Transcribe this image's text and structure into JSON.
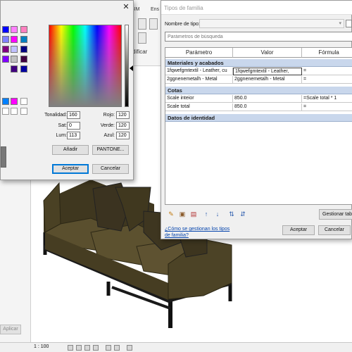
{
  "background": {
    "ribbon_tabs": [
      "BIM",
      "Ens"
    ],
    "ribbon_modify": "dificar",
    "apply_button": "Aplicar",
    "status_scale": "1 : 100"
  },
  "color_dialog": {
    "close_symbol": "✕",
    "fields": {
      "tonalidad": {
        "label": "Tonalidad:",
        "value": "160"
      },
      "sat": {
        "label": "Sat:",
        "value": "0"
      },
      "lum": {
        "label": "Lum:",
        "value": "113"
      },
      "rojo": {
        "label": "Rojo:",
        "value": "120"
      },
      "verde": {
        "label": "Verde:",
        "value": "120"
      },
      "azul": {
        "label": "Azul:",
        "value": "120"
      }
    },
    "add_button": "Añadir",
    "pantone_button": "PANTONE...",
    "accept_button": "Aceptar",
    "cancel_button": "Cancelar",
    "current_color": "#787878",
    "basic_colors": [
      "#0000ff",
      "#ff80ff",
      "#ff80c0",
      "#8080ff",
      "#ff00ff",
      "#0080c0",
      "#800080",
      "#c0c0ff",
      "#000080",
      "#8000ff",
      "#c0c0c0",
      "#400040",
      "#400080",
      "#0000a0"
    ],
    "custom_colors": [
      "#0080ff",
      "#ff00ff"
    ]
  },
  "type_dialog": {
    "title": "Tipos de familia",
    "type_name_label": "Nombre de tipo:",
    "search_placeholder": "Parámetros de búsqueda",
    "columns": [
      "Parámetro",
      "Valor",
      "Fórmula"
    ],
    "groups": [
      {
        "name": "Materiales y acabados",
        "rows": [
          {
            "param": "1fqwefgmtextil - Leather, cu",
            "value": "1fqwefgmtextil - Leather,",
            "formula": "="
          },
          {
            "param": "2ggnenemetalh - Metal",
            "value": "2ggnenemetalh - Metal",
            "formula": "="
          }
        ]
      },
      {
        "name": "Cotas",
        "rows": [
          {
            "param": "Scale inteior",
            "value": "850.0",
            "formula": "=Scale total * 1"
          },
          {
            "param": "Scale total",
            "value": "850.0",
            "formula": "="
          }
        ]
      },
      {
        "name": "Datos de identidad",
        "rows": []
      }
    ],
    "manage_tables_button": "Gestionar tablas",
    "help_link": "¿Cómo se gestionan los tipos de familia?",
    "accept_button": "Aceptar",
    "cancel_button": "Cancelar",
    "tool_icons": [
      "pencil-icon",
      "new-parameter-icon",
      "delete-parameter-icon",
      "move-up-icon",
      "move-down-icon",
      "sort-ascending-icon",
      "sort-descending-icon"
    ]
  },
  "colors": {
    "group_row": "#c9d7ec",
    "sofa_fabric": "#4f4527",
    "link": "#0645ad"
  }
}
